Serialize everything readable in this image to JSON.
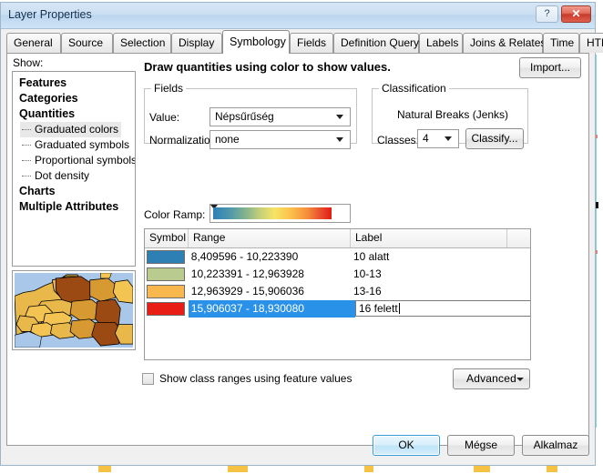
{
  "window": {
    "title": "Layer Properties",
    "help_button": "?",
    "close_button": "✕"
  },
  "tabs": [
    {
      "label": "General",
      "active": false
    },
    {
      "label": "Source",
      "active": false
    },
    {
      "label": "Selection",
      "active": false
    },
    {
      "label": "Display",
      "active": false
    },
    {
      "label": "Symbology",
      "active": true
    },
    {
      "label": "Fields",
      "active": false
    },
    {
      "label": "Definition Query",
      "active": false
    },
    {
      "label": "Labels",
      "active": false
    },
    {
      "label": "Joins & Relates",
      "active": false
    },
    {
      "label": "Time",
      "active": false
    },
    {
      "label": "HTML Popup",
      "active": false
    }
  ],
  "sidebar": {
    "show_label": "Show:",
    "items": [
      {
        "label": "Features",
        "type": "root",
        "selected": false
      },
      {
        "label": "Categories",
        "type": "root",
        "selected": false
      },
      {
        "label": "Quantities",
        "type": "root",
        "selected": false
      },
      {
        "label": "Graduated colors",
        "type": "child",
        "selected": true
      },
      {
        "label": "Graduated symbols",
        "type": "child",
        "selected": false
      },
      {
        "label": "Proportional symbols",
        "type": "child",
        "selected": false
      },
      {
        "label": "Dot density",
        "type": "child",
        "selected": false
      },
      {
        "label": "Charts",
        "type": "root",
        "selected": false
      },
      {
        "label": "Multiple Attributes",
        "type": "root",
        "selected": false
      }
    ]
  },
  "main": {
    "headline": "Draw quantities using color to show values.",
    "import_button": "Import...",
    "fields_group": {
      "legend": "Fields",
      "value_label": "Value:",
      "value_selected": "Népsűrűség",
      "normalization_label": "Normalization:",
      "normalization_selected": "none"
    },
    "classification_group": {
      "legend": "Classification",
      "method": "Natural Breaks (Jenks)",
      "classes_label": "Classes:",
      "classes_value": "4",
      "classify_button": "Classify..."
    },
    "color_ramp_label": "Color Ramp:",
    "table": {
      "columns": [
        "Symbol",
        "Range",
        "Label"
      ],
      "rows": [
        {
          "color": "#2e80b4",
          "range": "8,409596 - 10,223390",
          "label": "10 alatt",
          "selected": false,
          "editing": false
        },
        {
          "color": "#b9cb8e",
          "range": "10,223391 - 12,963928",
          "label": "10-13",
          "selected": false,
          "editing": false
        },
        {
          "color": "#f8b84e",
          "range": "12,963929 - 15,906036",
          "label": "13-16",
          "selected": false,
          "editing": false
        },
        {
          "color": "#e81d13",
          "range": "15,906037 - 18,930080",
          "label": "16 felett",
          "selected": true,
          "editing": true
        }
      ]
    },
    "show_class_ranges_label": "Show class ranges using feature values",
    "show_class_ranges_checked": false,
    "advanced_button": "Advanced"
  },
  "footer": {
    "ok": "OK",
    "cancel": "Mégse",
    "apply": "Alkalmaz"
  },
  "colors": {
    "accent": "#2a91e8",
    "title_bar": "#cbdff2",
    "panel": "#f0f0f0"
  }
}
